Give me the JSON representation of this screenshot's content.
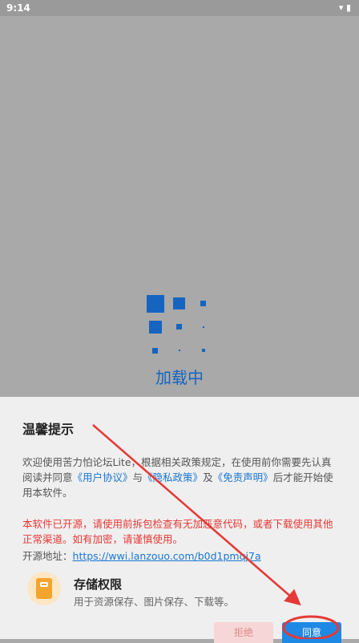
{
  "status_bar": {
    "time": "9:14",
    "icons": "▾ ▮"
  },
  "loading": {
    "text": "加载中",
    "accent": "#1565c0"
  },
  "dialog": {
    "title": "温馨提示",
    "intro_1": "欢迎使用苦力怕论坛Lite，根据相关政策规定，在使用前你需要先认真阅读并同意",
    "link_user_agreement": "《用户协议》",
    "and_1": "与",
    "link_privacy": "《隐私政策》",
    "and_2": "及",
    "link_disclaimer": "《免责声明》",
    "intro_2": "后才能开始使用本软件。",
    "warning": "本软件已开源，请使用前拆包检查有无加恶意代码，或者下载使用其他正常渠道。如有加密，请谨慎使用。",
    "source_label": "开源地址：",
    "source_url": "https://wwi.lanzouo.com/b0d1pmqj7a",
    "permission": {
      "icon": "storage-icon",
      "title": "存储权限",
      "desc": "用于资源保存、图片保存、下载等。"
    },
    "decline_label": "拒绝",
    "agree_label": "同意"
  }
}
